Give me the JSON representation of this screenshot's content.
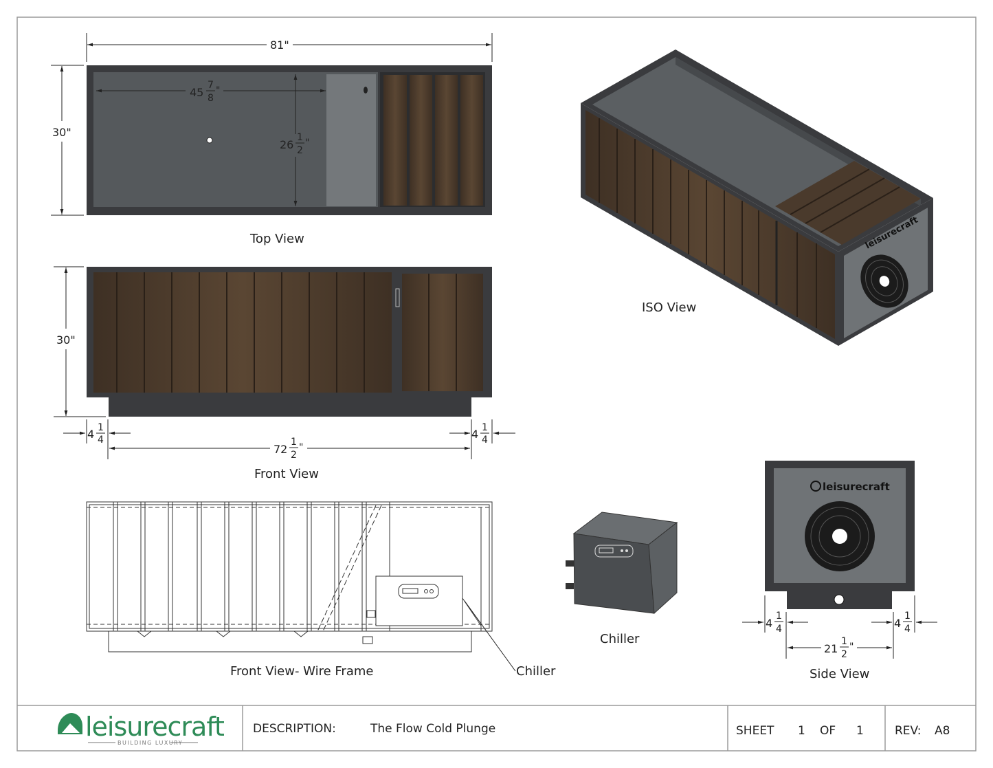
{
  "drawing": {
    "views": {
      "top": "Top View",
      "iso": "ISO View",
      "front": "Front View",
      "wire": "Front View- Wire Frame",
      "chiller": "Chiller",
      "side": "Side View",
      "callout": "Chiller"
    },
    "dims": {
      "length_total": "81\"",
      "height_top": "30\"",
      "inner_len_whole": "45",
      "inner_len_num": "7",
      "inner_len_den": "8",
      "inner_w_whole": "26",
      "inner_w_num": "1",
      "inner_w_den": "2",
      "height_front": "30\"",
      "offset_whole": "4",
      "offset_num": "1",
      "offset_den": "4",
      "base_whole": "72",
      "base_num": "1",
      "base_den": "2",
      "side_whole": "21",
      "side_num": "1",
      "side_den": "2",
      "inch": "\""
    },
    "logo_small": "leisurecraft"
  },
  "title_block": {
    "brand": "leisurecraft",
    "tagline": "BUILDING LUXURY",
    "description_label": "DESCRIPTION:",
    "description": "The Flow Cold Plunge",
    "sheet_label": "SHEET",
    "sheet_num": "1",
    "of_label": "OF",
    "sheet_total": "1",
    "rev_label": "REV:",
    "rev": "A8"
  },
  "colors": {
    "frame": "#3a3b3e",
    "panel": "#55595c",
    "wood": "#4a3a2c",
    "brand_green": "#2e8b57"
  }
}
